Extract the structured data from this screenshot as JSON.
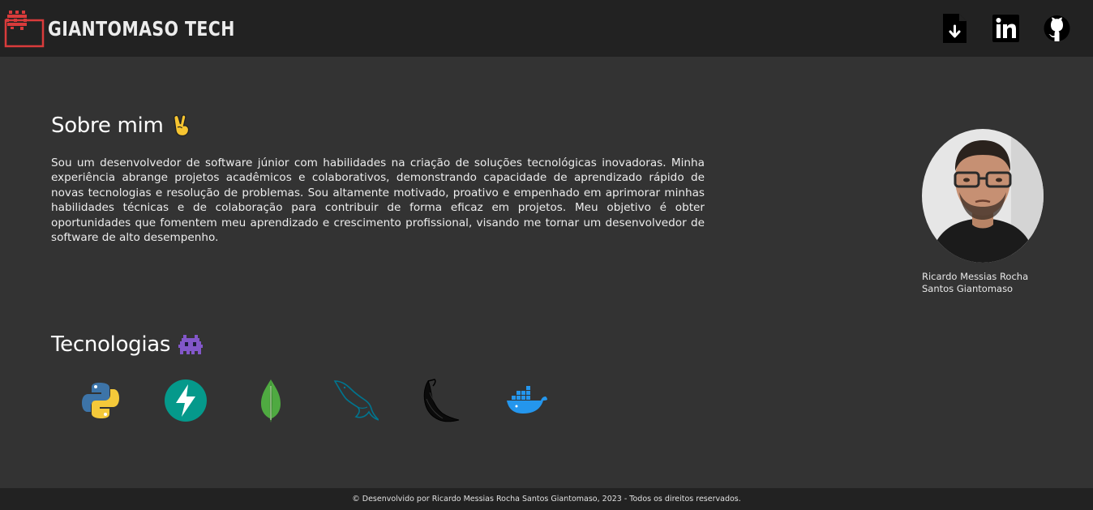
{
  "header": {
    "brand_name": "GIANTOMASO TECH",
    "icons": [
      "file-download-icon",
      "linkedin-icon",
      "github-icon"
    ]
  },
  "about": {
    "title": "Sobre mim",
    "emoji": "victory-hand-emoji",
    "text": "Sou um desenvolvedor de software júnior com habilidades na criação de soluções tecnológicas inovadoras. Minha experiência abrange projetos acadêmicos e colaborativos, demonstrando capacidade de aprendizado rápido de novas tecnologias e resolução de problemas. Sou altamente motivado, proativo e empenhado em aprimorar minhas habilidades técnicas e de colaboração para contribuir de forma eficaz em projetos. Meu objetivo é obter oportunidades que fomentem meu aprendizado e crescimento profissional, visando me tornar um desenvolvedor de software de alto desempenho."
  },
  "profile": {
    "name_line1": "Ricardo Messias Rocha",
    "name_line2": "Santos Giantomaso"
  },
  "tech": {
    "title": "Tecnologias",
    "emoji": "alien-monster-emoji",
    "items": [
      "python-icon",
      "fastapi-icon",
      "mongodb-icon",
      "mysql-icon",
      "flask-icon",
      "docker-icon"
    ]
  },
  "footer": {
    "text": "© Desenvolvido por Ricardo Messias Rocha Santos Giantomaso, 2023 - Todos os direitos reservados."
  },
  "colors": {
    "background": "#333333",
    "navbar": "#222222",
    "logo_red": "#d93b3b",
    "fastapi": "#05998b",
    "mongodb": "#4faa41",
    "mysql": "#00758f",
    "docker": "#2496ed"
  }
}
